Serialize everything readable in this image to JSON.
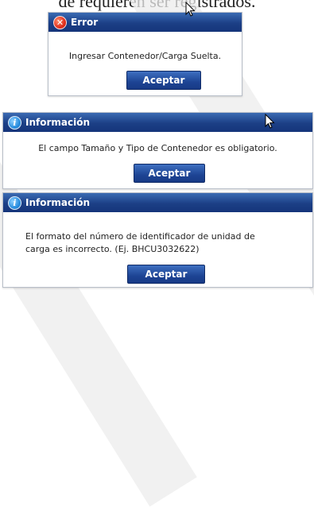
{
  "background_text": "de requieren ser registrados.",
  "dialogs": [
    {
      "title": "Error",
      "message": "Ingresar Contenedor/Carga Suelta.",
      "button": "Aceptar"
    },
    {
      "title": "Información",
      "message": "El campo Tamaño y Tipo de Contenedor es obligatorio.",
      "button": "Aceptar"
    },
    {
      "title": "Información",
      "message_line1": "El formato del número de identificador de unidad de",
      "message_line2": "carga es incorrecto. (Ej.  BHCU3032622)",
      "button": "Aceptar"
    }
  ],
  "icons": {
    "error": "error-x-icon",
    "info": "info-icon"
  },
  "colors": {
    "titlebar": "#1c3f86",
    "button": "#1d4494",
    "error_icon": "#e0301e",
    "info_icon": "#2a8fe0"
  }
}
